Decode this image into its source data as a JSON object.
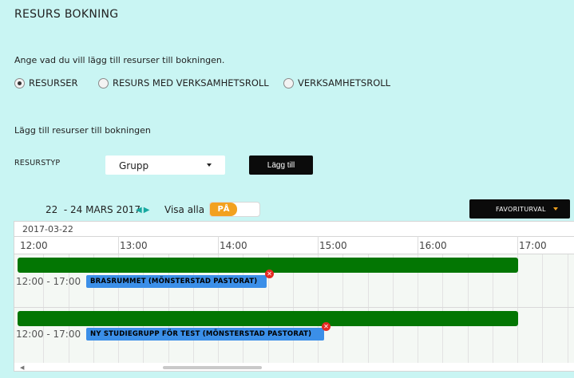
{
  "page": {
    "title": "RESURS BOKNING",
    "intro": "Ange vad du vill lägg till resurser till bokningen."
  },
  "radios": [
    {
      "label": "RESURSER",
      "checked": true
    },
    {
      "label": "RESURS MED VERKSAMHETSROLL",
      "checked": false
    },
    {
      "label": "VERKSAMHETSROLL",
      "checked": false
    }
  ],
  "add_section": {
    "label": "Lägg till resurser till bokningen",
    "resource_type_label": "RESURSTYP",
    "resource_type_value": "Grupp",
    "add_button": "Lägg till"
  },
  "toolbar": {
    "date_range": "22  - 24 MARS 2017",
    "visa_alla_label": "Visa alla",
    "toggle_label": "PÅ",
    "toggle_on": true,
    "favorites_button": "FAVORITURVAL",
    "accent_color": "#f2a11f"
  },
  "timeline": {
    "date": "2017-03-22",
    "hours": [
      "12:00",
      "13:00",
      "14:00",
      "15:00",
      "16:00",
      "17:00"
    ],
    "rows": [
      {
        "time": "12:00 - 17:00",
        "resource": "BRASRUMMET (MÖNSTERSTAD PASTORAT)"
      },
      {
        "time": "12:00 - 17:00",
        "resource": "NY STUDIEGRUPP FÖR TEST (MÖNSTERSTAD PASTORAT)"
      }
    ],
    "bar_color": "#037603",
    "badge_color": "#3b8fe8"
  }
}
